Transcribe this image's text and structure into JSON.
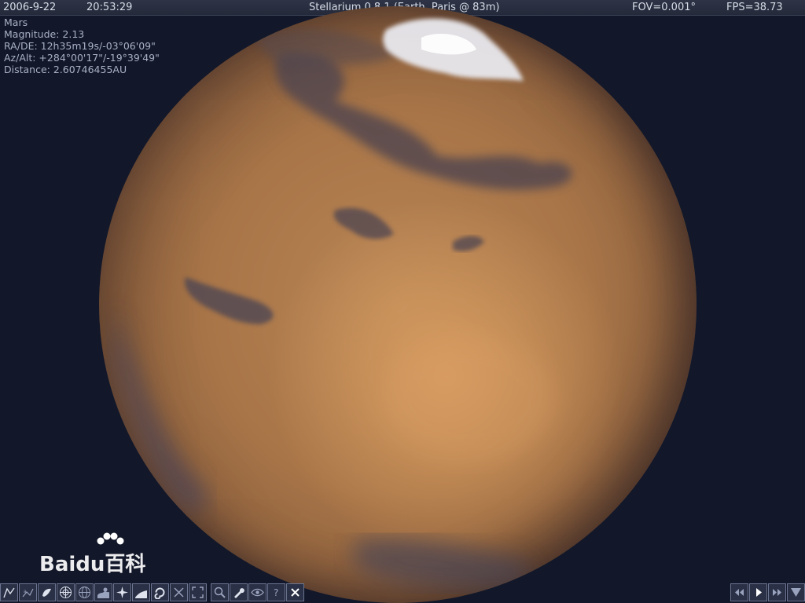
{
  "topbar": {
    "date": "2006-9-22",
    "time": "20:53:29",
    "title": "Stellarium 0.8.1 (Earth, Paris @ 83m)",
    "fov": "FOV=0.001°",
    "fps": "FPS=38.73"
  },
  "object_info": {
    "name": "Mars",
    "magnitude": "Magnitude: 2.13",
    "ra_de": "RA/DE: 12h35m19s/-03°06'09\"",
    "az_alt": "Az/Alt: +284°00'17\"/-19°39'49\"",
    "distance": "Distance: 2.60746455AU"
  },
  "watermark": {
    "text": "Baidu百科"
  },
  "toolbar_left": [
    {
      "name": "constellation-lines-icon"
    },
    {
      "name": "constellation-names-icon"
    },
    {
      "name": "constellation-art-icon"
    },
    {
      "name": "azimuthal-grid-icon"
    },
    {
      "name": "equatorial-grid-icon"
    },
    {
      "name": "ground-icon"
    },
    {
      "name": "cardinal-points-icon"
    },
    {
      "name": "atmosphere-icon"
    },
    {
      "name": "nebula-icon"
    },
    {
      "name": "night-mode-icon"
    },
    {
      "name": "fullscreen-icon"
    },
    {
      "name": "search-icon"
    },
    {
      "name": "config-icon"
    },
    {
      "name": "eye-icon"
    },
    {
      "name": "help-icon"
    },
    {
      "name": "close-icon"
    }
  ],
  "toolbar_right": [
    {
      "name": "rewind-icon"
    },
    {
      "name": "play-icon"
    },
    {
      "name": "fast-forward-icon"
    },
    {
      "name": "real-time-icon"
    }
  ],
  "colors": {
    "sky": "#121729",
    "bar": "#2a3045",
    "mars": "#a87548",
    "text": "#c9cede"
  }
}
